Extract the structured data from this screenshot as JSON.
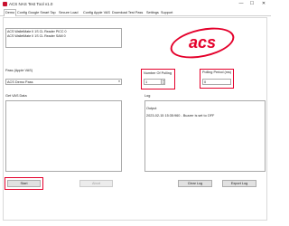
{
  "window": {
    "title": "ACS NAS Test Tool v1.0",
    "minimize": "—",
    "maximize": "☐",
    "close": "✕"
  },
  "tabs": [
    {
      "label": "Demo",
      "active": true
    },
    {
      "label": "Config Google Smart Tap",
      "active": false
    },
    {
      "label": "Secure Load",
      "active": false
    },
    {
      "label": "Config Apple VAS",
      "active": false
    },
    {
      "label": "Download Test Pass",
      "active": false
    },
    {
      "label": "Settings",
      "active": false
    },
    {
      "label": "Support",
      "active": false
    }
  ],
  "readers": [
    "ACS WalletMate II 1S CL Reader PICC 0",
    "ACS WalletMate II 1S CL Reader SAM 0"
  ],
  "logo": {
    "text": "acs",
    "color": "#e4002b"
  },
  "number_of_polling": {
    "label": "Number Of Polling",
    "value": "1"
  },
  "polling_period": {
    "label": "Polling Period (ms)",
    "value": "0"
  },
  "pass": {
    "label": "Pass (Apple VAS)",
    "value": "ACS Demo Pass"
  },
  "get_vas_data": {
    "label": "Get VAS Data"
  },
  "log": {
    "label": "Log",
    "heading": "Output",
    "lines": [
      "2023-02-15 15:35:960 - Buzzer is set to OFF"
    ]
  },
  "buttons": {
    "start": "Start",
    "abort": "Abort",
    "clear_log": "Clear Log",
    "export_log": "Export Log"
  },
  "highlight_color": "#e4002b"
}
